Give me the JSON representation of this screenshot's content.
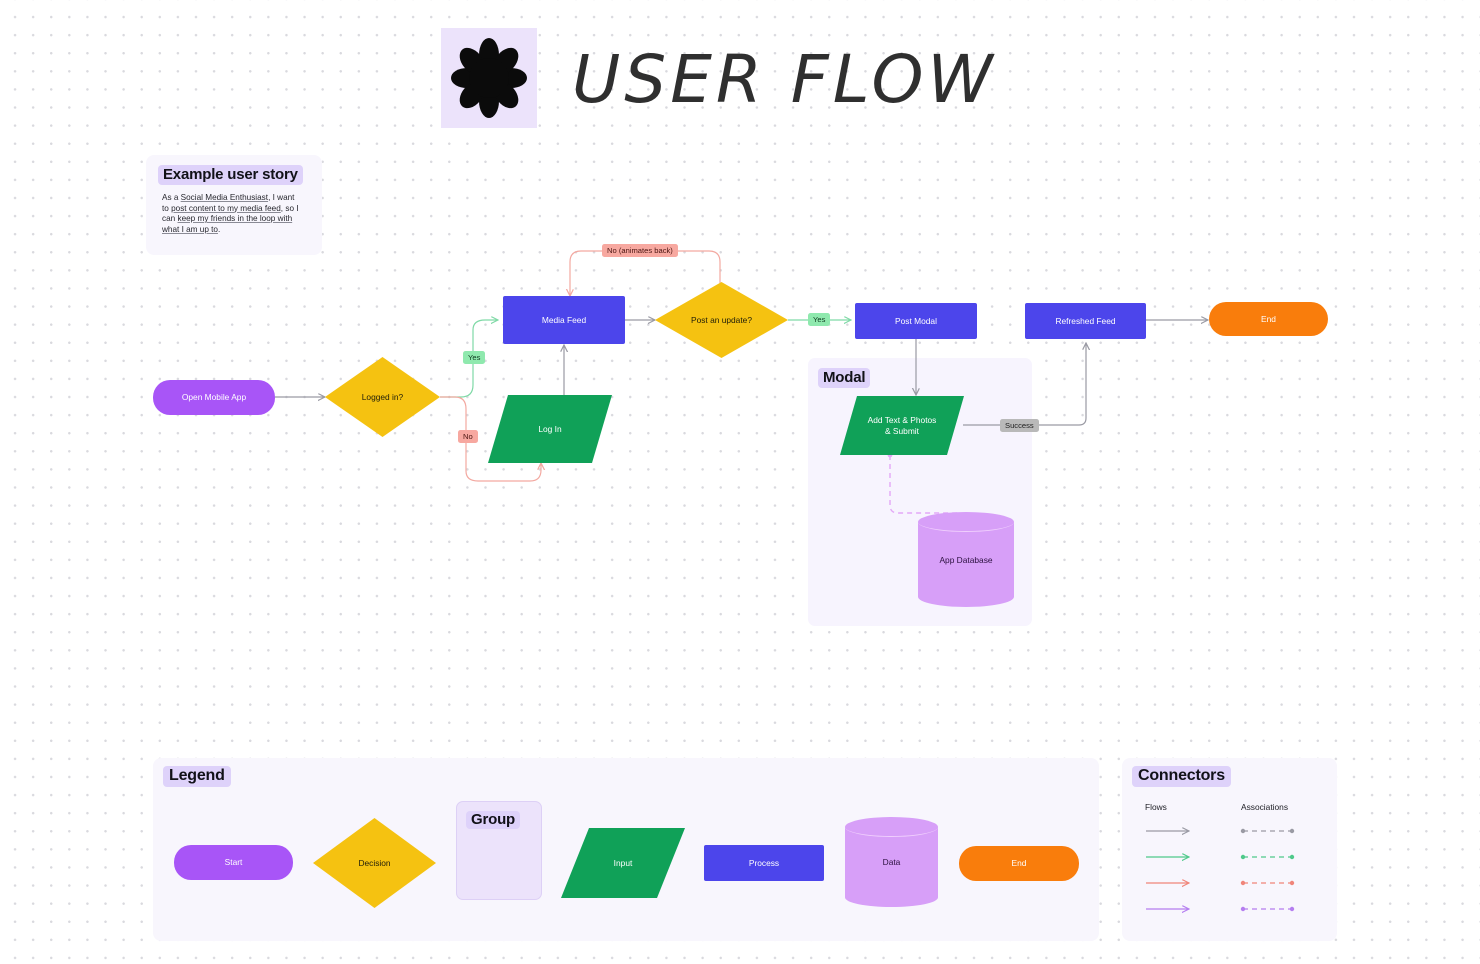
{
  "header": {
    "logo_icon": "flower-asterisk-icon",
    "title": "USER FLOW"
  },
  "story_card": {
    "title": "Example user story",
    "line1_prefix": "As a ",
    "line1_emph": "Social Media Enthusiast",
    "line1_suffix": ", I want",
    "line2_prefix": "to ",
    "line2_emph": "post content to my media feed",
    "line2_suffix": ", so",
    "line3_prefix": "I can ",
    "line3_emph": "keep my friends in the loop with",
    "line4_emph": "what I am up to",
    "line4_suffix": "."
  },
  "flow": {
    "nodes": [
      {
        "id": "open-mobile-app",
        "label": "Open Mobile App",
        "shape": "terminal",
        "color": "#a855f7"
      },
      {
        "id": "logged-in",
        "label": "Logged in?",
        "shape": "decision",
        "color": "#f5c211"
      },
      {
        "id": "log-in",
        "label": "Log In",
        "shape": "input",
        "color": "#10a158"
      },
      {
        "id": "media-feed",
        "label": "Media Feed",
        "shape": "process",
        "color": "#4c45eb"
      },
      {
        "id": "post-an-update",
        "label": "Post an update?",
        "shape": "decision",
        "color": "#f5c211"
      },
      {
        "id": "post-modal",
        "label": "Post Modal",
        "shape": "process",
        "color": "#4c45eb"
      },
      {
        "id": "add-text-photos",
        "label": "Add Text & Photos\n& Submit",
        "shape": "input",
        "color": "#10a158"
      },
      {
        "id": "app-database",
        "label": "App Database",
        "shape": "data",
        "color": "#d79ff8"
      },
      {
        "id": "refreshed-feed",
        "label": "Refreshed Feed",
        "shape": "process",
        "color": "#4c45eb"
      },
      {
        "id": "end",
        "label": "End",
        "shape": "terminal",
        "color": "#f97d0c"
      }
    ],
    "edge_labels": {
      "yes_logged_in": "Yes",
      "no_logged_in": "No",
      "yes_post_update": "Yes",
      "no_animates_back": "No (animates back)",
      "success": "Success"
    },
    "modal_group_title": "Modal"
  },
  "legend": {
    "title": "Legend",
    "items": [
      {
        "label": "Start",
        "shape": "terminal",
        "color": "#a855f7"
      },
      {
        "label": "Decision",
        "shape": "decision",
        "color": "#f5c211"
      },
      {
        "label": "Group",
        "shape": "group",
        "color": "#ece3fb"
      },
      {
        "label": "Input",
        "shape": "input",
        "color": "#10a158"
      },
      {
        "label": "Process",
        "shape": "process",
        "color": "#4c45eb"
      },
      {
        "label": "Data",
        "shape": "data",
        "color": "#d79ff8"
      },
      {
        "label": "End",
        "shape": "terminal",
        "color": "#f97d0c"
      }
    ]
  },
  "connectors": {
    "title": "Connectors",
    "col_flows": "Flows",
    "col_associations": "Associations",
    "colors": [
      "#9a9aa4",
      "#4fc98a",
      "#f0857a",
      "#b57ef0"
    ]
  },
  "palette": {
    "canvas_bg": "#ffffff",
    "dot": "#d9d9de",
    "panel_bg": "#f8f6fd",
    "accent_lavender": "#ded2fa",
    "edge_gray": "#9a9aa4",
    "edge_green": "#7fd9a6",
    "edge_red": "#f3a9a1",
    "edge_purple": "#d79ff8"
  }
}
